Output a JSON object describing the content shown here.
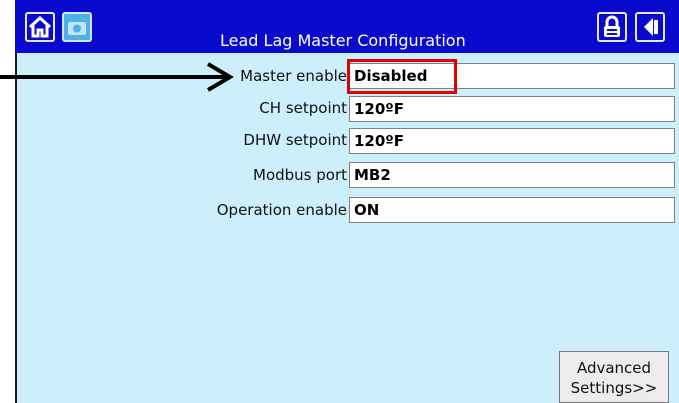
{
  "header": {
    "title": "Lead Lag Master Configuration",
    "icons": [
      "home-icon",
      "camera-icon",
      "lock-icon",
      "back-icon"
    ]
  },
  "fields": [
    {
      "label": "Master enable",
      "value": "Disabled"
    },
    {
      "label": "CH setpoint",
      "value": "120ºF"
    },
    {
      "label": "DHW setpoint",
      "value": "120ºF"
    },
    {
      "label": "Modbus port",
      "value": "MB2"
    },
    {
      "label": "Operation enable",
      "value": "ON"
    }
  ],
  "advanced_button": {
    "line1": "Advanced",
    "line2": "Settings>>"
  },
  "colors": {
    "titlebar": "#0a0acf",
    "background": "#cdeefb",
    "highlight": "#e00000"
  }
}
